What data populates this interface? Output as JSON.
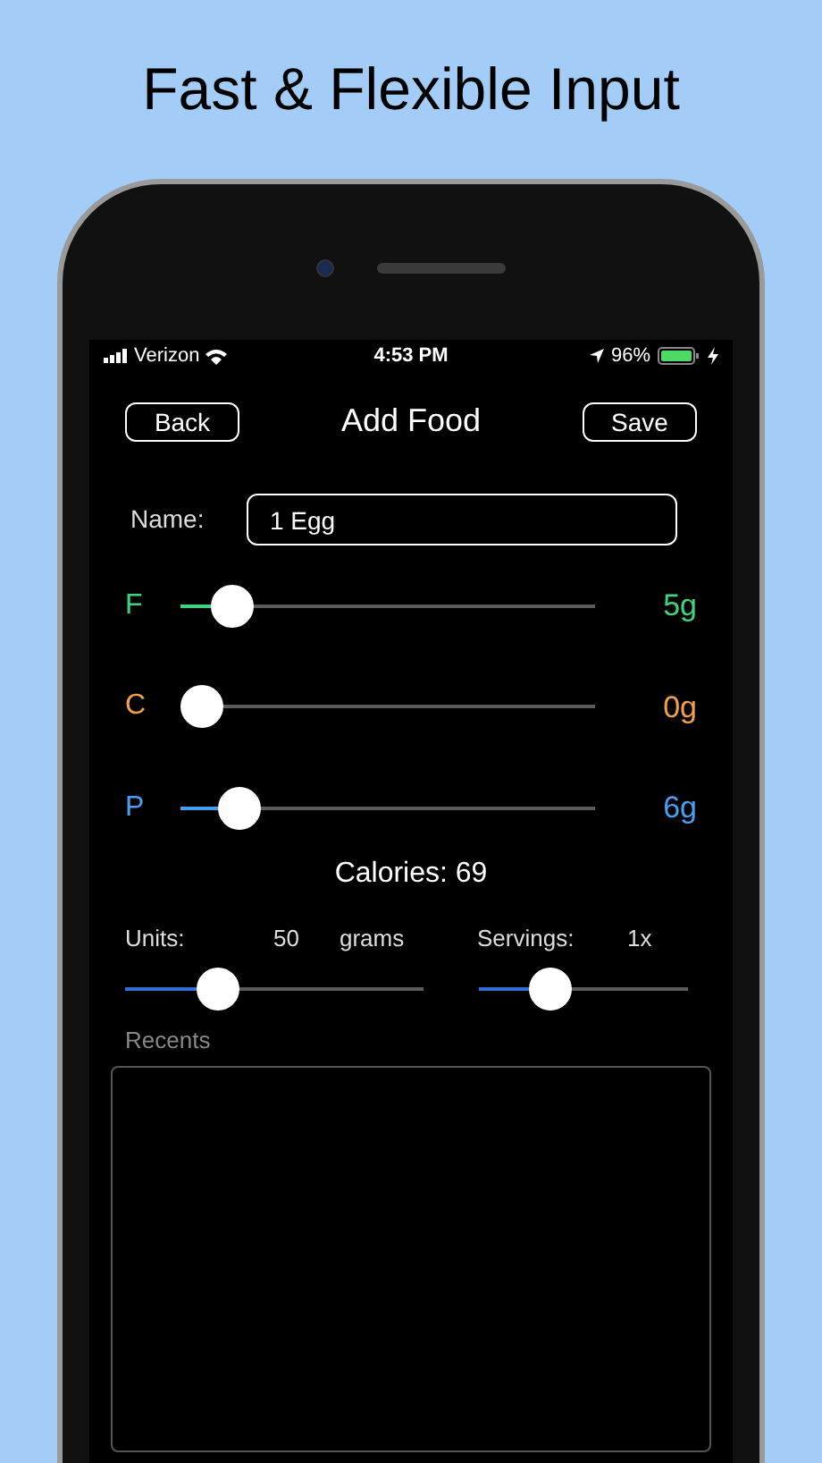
{
  "headline": "Fast & Flexible Input",
  "status_bar": {
    "carrier": "Verizon",
    "time": "4:53 PM",
    "battery": "96%"
  },
  "nav": {
    "back": "Back",
    "title": "Add Food",
    "save": "Save"
  },
  "name_field": {
    "label": "Name:",
    "value": "1 Egg"
  },
  "macros": [
    {
      "letter": "F",
      "color": "#3fd37f",
      "level": 0.08,
      "reading": "5g"
    },
    {
      "letter": "C",
      "color": "#f0a04b",
      "level": 0.0,
      "reading": "0g"
    },
    {
      "letter": "P",
      "color": "#4a9eef",
      "level": 0.1,
      "reading": "6g"
    }
  ],
  "calories": "Calories: 69",
  "units": {
    "label": "Units:",
    "value": "50",
    "unit": "grams",
    "level": 0.28
  },
  "servings": {
    "label": "Servings:",
    "value": "1x",
    "level": 0.3
  },
  "recents": {
    "label": "Recents"
  }
}
